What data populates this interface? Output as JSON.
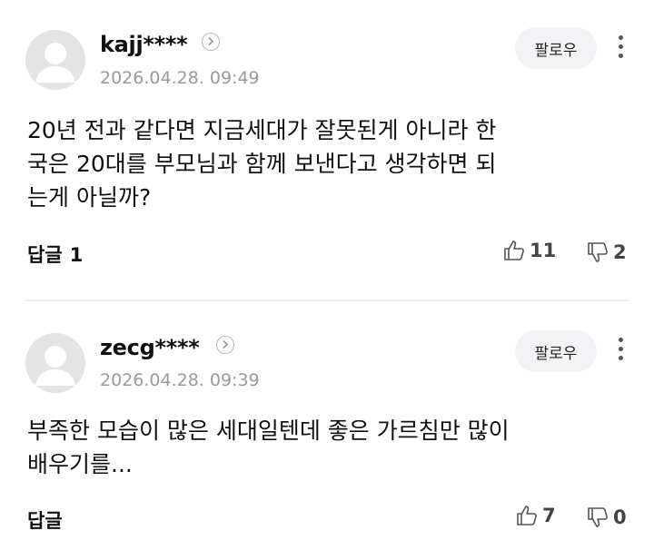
{
  "comments": [
    {
      "username": "kajj****",
      "timestamp": "2026.04.28. 09:49",
      "follow_label": "팔로우",
      "body_lines": [
        "20년 전과 같다면 지금세대가 잘못된게 아니라 한",
        "국은 20대를 부모님과 함께 보낸다고 생각하면 되",
        "는게 아닐까?"
      ],
      "reply_label": "답글",
      "reply_count": "1",
      "likes": "11",
      "dislikes": "2"
    },
    {
      "username": "zecg****",
      "timestamp": "2026.04.28. 09:39",
      "follow_label": "팔로우",
      "body_lines": [
        "부족한 모습이 많은 세대일텐데 좋은 가르침만 많이",
        "배우기를..."
      ],
      "reply_label": "답글",
      "reply_count": "",
      "likes": "7",
      "dislikes": "0"
    }
  ],
  "icons": {
    "avatar": "default-avatar-icon",
    "profile_link": "chevron-right-icon",
    "more": "more-vertical-icon",
    "like": "thumbs-up-icon",
    "dislike": "thumbs-down-icon"
  },
  "colors": {
    "avatar_bg": "#e4e4e4",
    "follow_bg": "#f3f3f5",
    "muted_text": "#9a9a9a"
  }
}
